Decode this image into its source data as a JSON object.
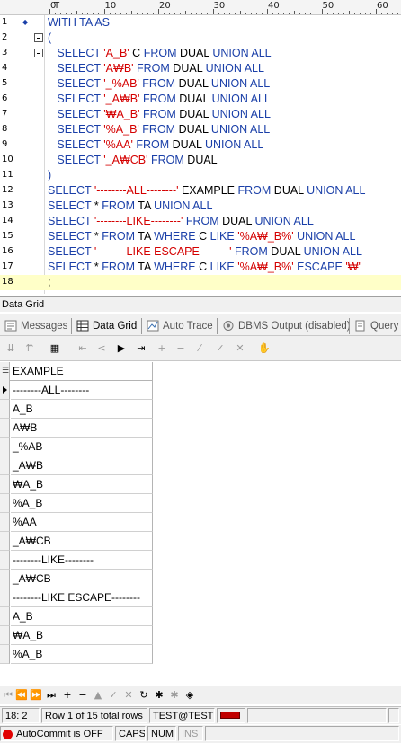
{
  "ruler": {
    "ticks": [
      "0",
      "10",
      "20",
      "30",
      "40",
      "50",
      "60"
    ],
    "marker": "T"
  },
  "editor": {
    "lines": [
      {
        "n": "1",
        "tokens": [
          {
            "t": "WITH TA AS",
            "c": "kw"
          }
        ]
      },
      {
        "n": "2",
        "tokens": [
          {
            "t": "(",
            "c": "kw"
          }
        ]
      },
      {
        "n": "3",
        "tokens": [
          {
            "t": "   SELECT ",
            "c": "kw"
          },
          {
            "t": "'A_B'",
            "c": "str"
          },
          {
            "t": " C ",
            "c": "plain"
          },
          {
            "t": "FROM",
            "c": "kw"
          },
          {
            "t": " DUAL ",
            "c": "plain"
          },
          {
            "t": "UNION ALL",
            "c": "kw"
          }
        ]
      },
      {
        "n": "4",
        "tokens": [
          {
            "t": "   SELECT ",
            "c": "kw"
          },
          {
            "t": "'A₩B'",
            "c": "str"
          },
          {
            "t": " FROM",
            "c": "kw"
          },
          {
            "t": " DUAL ",
            "c": "plain"
          },
          {
            "t": "UNION ALL",
            "c": "kw"
          }
        ]
      },
      {
        "n": "5",
        "tokens": [
          {
            "t": "   SELECT ",
            "c": "kw"
          },
          {
            "t": "'_%AB'",
            "c": "str"
          },
          {
            "t": " FROM",
            "c": "kw"
          },
          {
            "t": " DUAL ",
            "c": "plain"
          },
          {
            "t": "UNION ALL",
            "c": "kw"
          }
        ]
      },
      {
        "n": "6",
        "tokens": [
          {
            "t": "   SELECT ",
            "c": "kw"
          },
          {
            "t": "'_A₩B'",
            "c": "str"
          },
          {
            "t": " FROM",
            "c": "kw"
          },
          {
            "t": " DUAL ",
            "c": "plain"
          },
          {
            "t": "UNION ALL",
            "c": "kw"
          }
        ]
      },
      {
        "n": "7",
        "tokens": [
          {
            "t": "   SELECT ",
            "c": "kw"
          },
          {
            "t": "'₩A_B'",
            "c": "str"
          },
          {
            "t": " FROM",
            "c": "kw"
          },
          {
            "t": " DUAL ",
            "c": "plain"
          },
          {
            "t": "UNION ALL",
            "c": "kw"
          }
        ]
      },
      {
        "n": "8",
        "tokens": [
          {
            "t": "   SELECT ",
            "c": "kw"
          },
          {
            "t": "'%A_B'",
            "c": "str"
          },
          {
            "t": " FROM",
            "c": "kw"
          },
          {
            "t": " DUAL ",
            "c": "plain"
          },
          {
            "t": "UNION ALL",
            "c": "kw"
          }
        ]
      },
      {
        "n": "9",
        "tokens": [
          {
            "t": "   SELECT ",
            "c": "kw"
          },
          {
            "t": "'%AA'",
            "c": "str"
          },
          {
            "t": " FROM",
            "c": "kw"
          },
          {
            "t": " DUAL ",
            "c": "plain"
          },
          {
            "t": "UNION ALL",
            "c": "kw"
          }
        ]
      },
      {
        "n": "10",
        "tokens": [
          {
            "t": "   SELECT ",
            "c": "kw"
          },
          {
            "t": "'_A₩CB'",
            "c": "str"
          },
          {
            "t": " FROM",
            "c": "kw"
          },
          {
            "t": " DUAL",
            "c": "plain"
          }
        ]
      },
      {
        "n": "11",
        "tokens": [
          {
            "t": ")",
            "c": "kw"
          }
        ]
      },
      {
        "n": "12",
        "tokens": [
          {
            "t": "SELECT ",
            "c": "kw"
          },
          {
            "t": "'--------ALL--------'",
            "c": "str"
          },
          {
            "t": " EXAMPLE ",
            "c": "plain"
          },
          {
            "t": "FROM",
            "c": "kw"
          },
          {
            "t": " DUAL ",
            "c": "plain"
          },
          {
            "t": "UNION ALL",
            "c": "kw"
          }
        ]
      },
      {
        "n": "13",
        "tokens": [
          {
            "t": "SELECT",
            "c": "kw"
          },
          {
            "t": " * ",
            "c": "plain"
          },
          {
            "t": "FROM",
            "c": "kw"
          },
          {
            "t": " TA ",
            "c": "plain"
          },
          {
            "t": "UNION ALL",
            "c": "kw"
          }
        ]
      },
      {
        "n": "14",
        "tokens": [
          {
            "t": "SELECT ",
            "c": "kw"
          },
          {
            "t": "'--------LIKE--------'",
            "c": "str"
          },
          {
            "t": " FROM",
            "c": "kw"
          },
          {
            "t": " DUAL ",
            "c": "plain"
          },
          {
            "t": "UNION ALL",
            "c": "kw"
          }
        ]
      },
      {
        "n": "15",
        "tokens": [
          {
            "t": "SELECT",
            "c": "kw"
          },
          {
            "t": " * ",
            "c": "plain"
          },
          {
            "t": "FROM",
            "c": "kw"
          },
          {
            "t": " TA ",
            "c": "plain"
          },
          {
            "t": "WHERE",
            "c": "kw"
          },
          {
            "t": " C ",
            "c": "plain"
          },
          {
            "t": "LIKE ",
            "c": "kw"
          },
          {
            "t": "'%A₩_B%'",
            "c": "str"
          },
          {
            "t": " UNION ALL",
            "c": "kw"
          }
        ]
      },
      {
        "n": "16",
        "tokens": [
          {
            "t": "SELECT ",
            "c": "kw"
          },
          {
            "t": "'--------LIKE ESCAPE--------'",
            "c": "str"
          },
          {
            "t": " FROM",
            "c": "kw"
          },
          {
            "t": " DUAL ",
            "c": "plain"
          },
          {
            "t": "UNION ALL",
            "c": "kw"
          }
        ]
      },
      {
        "n": "17",
        "tokens": [
          {
            "t": "SELECT",
            "c": "kw"
          },
          {
            "t": " * ",
            "c": "plain"
          },
          {
            "t": "FROM",
            "c": "kw"
          },
          {
            "t": " TA ",
            "c": "plain"
          },
          {
            "t": "WHERE",
            "c": "kw"
          },
          {
            "t": " C ",
            "c": "plain"
          },
          {
            "t": "LIKE ",
            "c": "kw"
          },
          {
            "t": "'%A₩_B%'",
            "c": "str"
          },
          {
            "t": " ESCAPE ",
            "c": "kw"
          },
          {
            "t": "'₩'",
            "c": "str"
          }
        ]
      },
      {
        "n": "18",
        "tokens": [
          {
            "t": ";",
            "c": "plain"
          }
        ]
      }
    ]
  },
  "panel": {
    "title": "Data Grid"
  },
  "tabs": [
    {
      "label": "Messages",
      "icon": "messages-icon"
    },
    {
      "label": "Data Grid",
      "icon": "grid-icon"
    },
    {
      "label": "Auto Trace",
      "icon": "trace-icon"
    },
    {
      "label": "DBMS Output (disabled)",
      "icon": "dbms-output-icon"
    },
    {
      "label": "Query",
      "icon": "query-icon"
    }
  ],
  "grid": {
    "column": "EXAMPLE",
    "rows": [
      "--------ALL--------",
      "A_B",
      "A₩B",
      "_%AB",
      "_A₩B",
      "₩A_B",
      "%A_B",
      "%AA",
      "_A₩CB",
      "--------LIKE--------",
      "_A₩CB",
      "--------LIKE ESCAPE--------",
      "A_B",
      "₩A_B",
      "%A_B"
    ]
  },
  "status": {
    "position": "18:  2",
    "rows": "Row 1 of 15 total rows",
    "connection": "TEST@TEST",
    "autocommit": "AutoCommit is OFF",
    "caps": "CAPS",
    "num": "NUM",
    "ins": "INS"
  },
  "colors": {
    "keyword": "#1a3fa8",
    "string": "#d40000",
    "current_line": "#ffffc8"
  }
}
